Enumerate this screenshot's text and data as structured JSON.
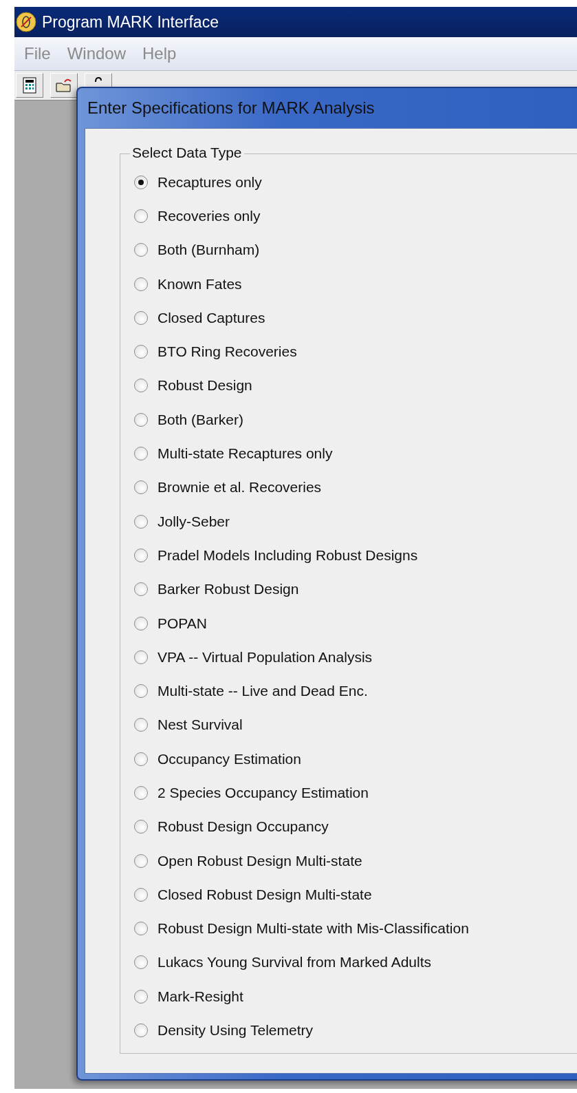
{
  "window": {
    "title": "Program MARK Interface"
  },
  "menu": [
    "File",
    "Window",
    "Help"
  ],
  "dialog": {
    "title": "Enter Specifications for MARK Analysis",
    "group": {
      "label": "Select Data Type",
      "options": [
        {
          "label": "Recaptures only",
          "selected": true
        },
        {
          "label": "Recoveries only",
          "selected": false
        },
        {
          "label": "Both (Burnham)",
          "selected": false
        },
        {
          "label": "Known Fates",
          "selected": false
        },
        {
          "label": "Closed Captures",
          "selected": false
        },
        {
          "label": "BTO Ring Recoveries",
          "selected": false
        },
        {
          "label": "Robust Design",
          "selected": false
        },
        {
          "label": "Both (Barker)",
          "selected": false
        },
        {
          "label": "Multi-state Recaptures only",
          "selected": false
        },
        {
          "label": "Brownie et al. Recoveries",
          "selected": false
        },
        {
          "label": "Jolly-Seber",
          "selected": false
        },
        {
          "label": "Pradel Models Including Robust Designs",
          "selected": false
        },
        {
          "label": "Barker Robust Design",
          "selected": false
        },
        {
          "label": "POPAN",
          "selected": false
        },
        {
          "label": "VPA -- Virtual Population Analysis",
          "selected": false
        },
        {
          "label": "Multi-state -- Live and Dead Enc.",
          "selected": false
        },
        {
          "label": "Nest Survival",
          "selected": false
        },
        {
          "label": "Occupancy Estimation",
          "selected": false
        },
        {
          "label": "2 Species Occupancy Estimation",
          "selected": false
        },
        {
          "label": "Robust Design Occupancy",
          "selected": false
        },
        {
          "label": "Open Robust Design Multi-state",
          "selected": false
        },
        {
          "label": "Closed Robust Design Multi-state",
          "selected": false
        },
        {
          "label": "Robust Design Multi-state with Mis-Classification",
          "selected": false
        },
        {
          "label": "Lukacs Young Survival from Marked Adults",
          "selected": false
        },
        {
          "label": "Mark-Resight",
          "selected": false
        },
        {
          "label": "Density Using Telemetry",
          "selected": false
        }
      ]
    }
  }
}
